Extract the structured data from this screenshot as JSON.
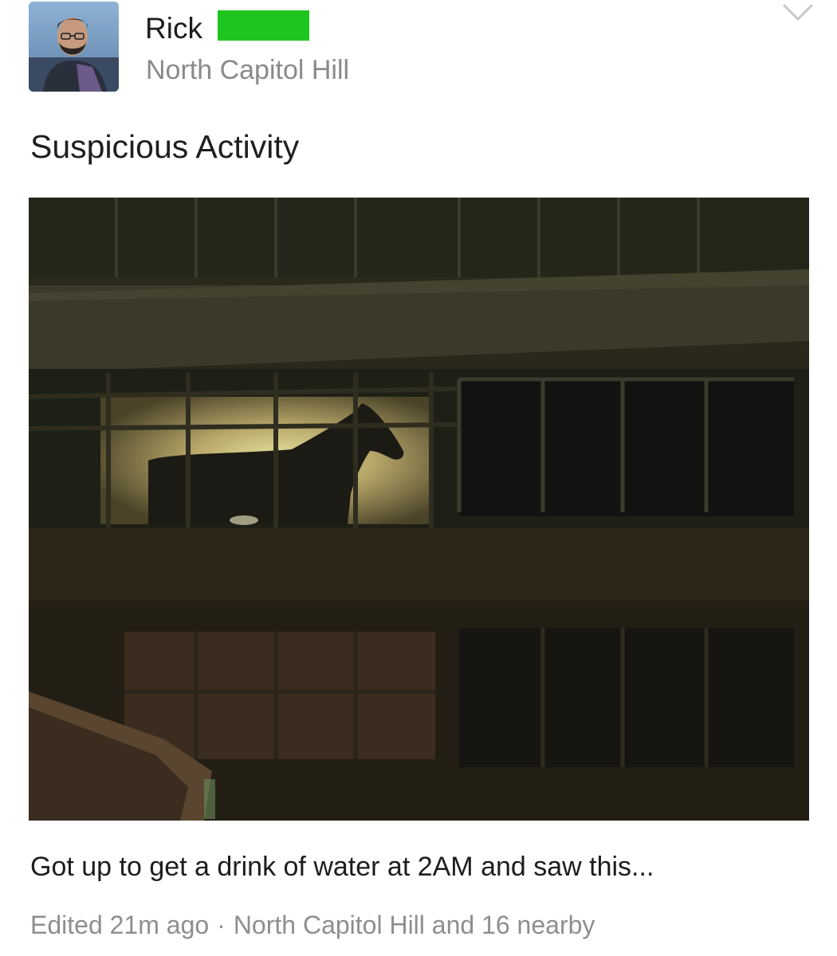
{
  "post": {
    "author": {
      "name": "Rick",
      "avatar_icon": "person-avatar",
      "redaction_color": "#1ec51e"
    },
    "location": "North Capitol Hill",
    "menu_icon": "chevron-down-icon",
    "title": "Suspicious Activity",
    "photo": {
      "subject": "horse-silhouette-on-balcony-photo"
    },
    "body": "Got up to get a drink of water at 2AM and saw this...",
    "meta": {
      "edited": "Edited 21m ago",
      "separator": "·",
      "area": "North Capitol Hill and 16 nearby"
    }
  },
  "colors": {
    "text_primary": "#1c1c1c",
    "text_secondary": "#8a8a8a",
    "background": "#ffffff"
  }
}
